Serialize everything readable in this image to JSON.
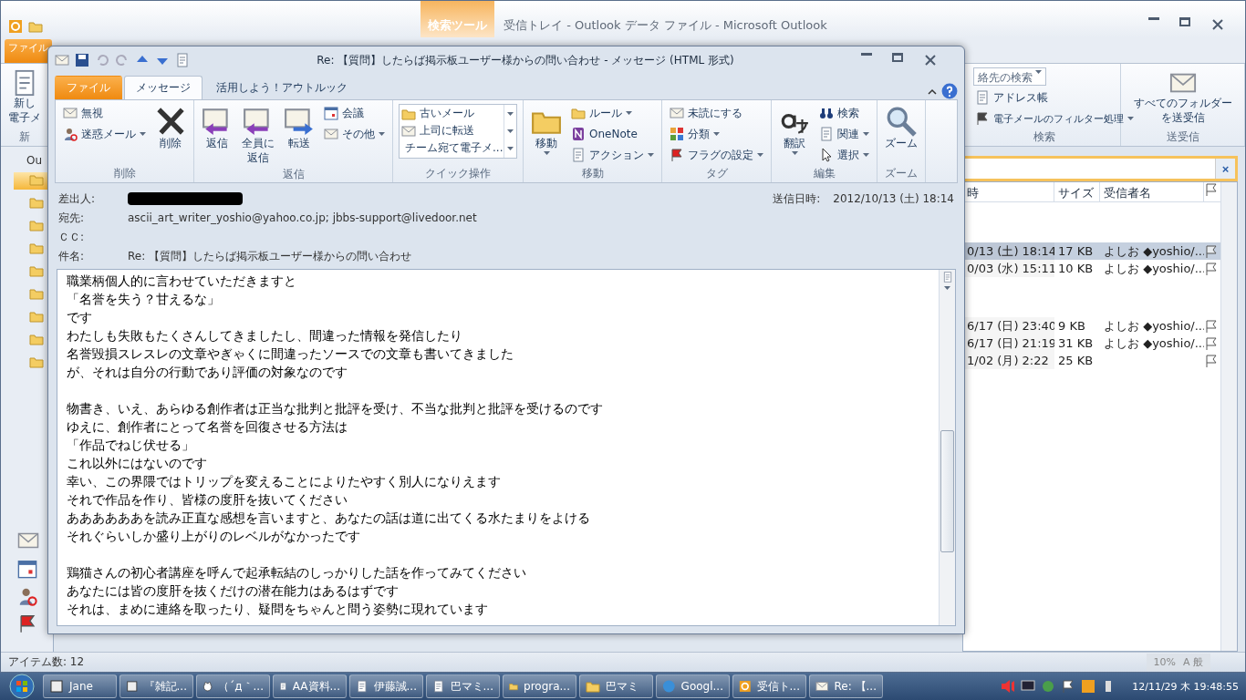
{
  "main_window": {
    "context_tab": "検索ツール",
    "title": "受信トレイ - Outlook データ ファイル - Microsoft Outlook",
    "file_tab": "ファイル",
    "new_button": {
      "lines": [
        "新し",
        "電子メ"
      ],
      "group": "新"
    },
    "contacts_search": "絡先の検索",
    "address_book": "アドレス帳",
    "filter": "電子メールのフィルター処理",
    "search_group": "検索",
    "send_receive": {
      "lines": [
        "すべてのフォルダー",
        "を送受信"
      ]
    },
    "send_group": "送受信",
    "nav_root": "Ou",
    "columns": [
      "時",
      "サイズ",
      "受信者名"
    ],
    "row_groups": [
      [
        {
          "date": "0/13 (土) 18:14",
          "size": "17 KB",
          "recipient": "よしお ◆yoshio/...",
          "selected": true
        },
        {
          "date": "0/03 (水) 15:11",
          "size": "10 KB",
          "recipient": "よしお ◆yoshio/...",
          "selected": false
        }
      ],
      [
        {
          "date": "6/17 (日) 23:40",
          "size": "9 KB",
          "recipient": "よしお ◆yoshio/...",
          "selected": false
        },
        {
          "date": "6/17 (日) 21:19",
          "size": "31 KB",
          "recipient": "よしお ◆yoshio/...",
          "selected": false
        },
        {
          "date": "1/02 (月) 2:22",
          "size": "25 KB",
          "selected": false
        }
      ]
    ],
    "search_clear": "×",
    "status": "アイテム数: 12",
    "ime_zoom": "10%",
    "ime_mode": "A 般"
  },
  "message_window": {
    "title": "Re: 【質問】したらば掲示板ユーザー様からの問い合わせ - メッセージ (HTML 形式)",
    "tabs": [
      {
        "label": "ファイル",
        "kind": "file",
        "selected": false
      },
      {
        "label": "メッセージ",
        "kind": "tab",
        "selected": true
      },
      {
        "label": "活用しよう！アウトルック",
        "kind": "tab",
        "selected": false
      }
    ],
    "groups": [
      {
        "label": "削除",
        "items": [
          {
            "kind": "small",
            "label": "無視",
            "dropdown": false
          },
          {
            "kind": "small",
            "label": "迷惑メール",
            "dropdown": true
          },
          {
            "kind": "large",
            "lines": [
              "削除"
            ],
            "dropdown": false
          }
        ]
      },
      {
        "label": "返信",
        "items": [
          {
            "kind": "large",
            "lines": [
              "返信"
            ],
            "dropdown": false
          },
          {
            "kind": "large",
            "lines": [
              "全員に",
              "返信"
            ],
            "dropdown": false
          },
          {
            "kind": "large",
            "lines": [
              "転送"
            ],
            "dropdown": false
          },
          {
            "kind": "small",
            "label": "会議",
            "dropdown": false
          },
          {
            "kind": "small",
            "label": "その他",
            "dropdown": true
          }
        ]
      },
      {
        "label": "クイック操作",
        "items": [
          {
            "kind": "gallery",
            "entries": [
              "古いメール",
              "上司に転送",
              "チーム宛て電子メ..."
            ]
          }
        ]
      },
      {
        "label": "移動",
        "items": [
          {
            "kind": "large",
            "lines": [
              "移動"
            ],
            "dropdown": true
          },
          {
            "kind": "small",
            "label": "ルール",
            "dropdown": true
          },
          {
            "kind": "small",
            "label": "OneNote",
            "dropdown": false
          },
          {
            "kind": "small",
            "label": "アクション",
            "dropdown": true
          }
        ]
      },
      {
        "label": "タグ",
        "items": [
          {
            "kind": "small",
            "label": "未読にする",
            "dropdown": false
          },
          {
            "kind": "small",
            "label": "分類",
            "dropdown": true
          },
          {
            "kind": "small",
            "label": "フラグの設定",
            "dropdown": true
          }
        ]
      },
      {
        "label": "編集",
        "items": [
          {
            "kind": "large",
            "lines": [
              "翻訳"
            ],
            "dropdown": true
          },
          {
            "kind": "small",
            "label": "検索",
            "dropdown": false
          },
          {
            "kind": "small",
            "label": "関連",
            "dropdown": true
          },
          {
            "kind": "small",
            "label": "選択",
            "dropdown": true
          }
        ]
      },
      {
        "label": "ズーム",
        "items": [
          {
            "kind": "large",
            "lines": [
              "ズーム"
            ],
            "dropdown": false
          }
        ]
      }
    ],
    "header": {
      "from_label": "差出人:",
      "sent_label": "送信日時:",
      "sent_value": "2012/10/13 (土) 18:14",
      "to_label": "宛先:",
      "to_value": "ascii_art_writer_yoshio@yahoo.co.jp; jbbs-support@livedoor.net",
      "cc_label": "ＣＣ:",
      "subject_label": "件名:",
      "subject_value": "Re: 【質問】したらば掲示板ユーザー様からの問い合わせ"
    },
    "body": [
      [
        "職業柄個人的に言わせていただきますと",
        "「名誉を失う？甘えるな」",
        "です",
        "わたしも失敗もたくさんしてきましたし、間違った情報を発信したり",
        "名誉毀損スレスレの文章やぎゃくに間違ったソースでの文章も書いてきました",
        "が、それは自分の行動であり評価の対象なのです"
      ],
      [
        "物書き、いえ、あらゆる創作者は正当な批判と批評を受け、不当な批判と批評を受けるのです",
        "ゆえに、創作者にとって名誉を回復させる方法は",
        "「作品でねじ伏せる」",
        "これ以外にはないのです",
        "幸い、この界隈ではトリップを変えることによりたやすく別人になりえます",
        "それで作品を作り、皆様の度肝を抜いてください",
        "ああああああを読み正直な感想を言いますと、あなたの話は道に出てくる水たまりをよける",
        "それぐらいしか盛り上がりのレベルがなかったです"
      ],
      [
        "鶏猫さんの初心者講座を呼んで起承転結のしっかりした話を作ってみてください",
        "あなたには皆の度肝を抜くだけの潜在能力はあるはずです",
        "それは、まめに連絡を取ったり、疑問をちゃんと問う姿勢に現れています"
      ]
    ]
  },
  "taskbar": {
    "items": [
      {
        "label": "Jane",
        "kind": "app"
      },
      {
        "label": "『雑記...",
        "kind": "app"
      },
      {
        "label": "（´д｀...",
        "kind": "cat"
      },
      {
        "label": "AA資料...",
        "kind": "text"
      },
      {
        "label": "伊藤誠...",
        "kind": "text"
      },
      {
        "label": "巴マミ...",
        "kind": "text"
      },
      {
        "label": "progra...",
        "kind": "folder"
      },
      {
        "label": "巴マミ",
        "kind": "folder"
      },
      {
        "label": "Googl...",
        "kind": "browser"
      },
      {
        "label": "受信ト...",
        "kind": "outlook"
      },
      {
        "label": "Re: 【...",
        "kind": "mail"
      }
    ],
    "clock": "12/11/29 木 19:48:55"
  }
}
